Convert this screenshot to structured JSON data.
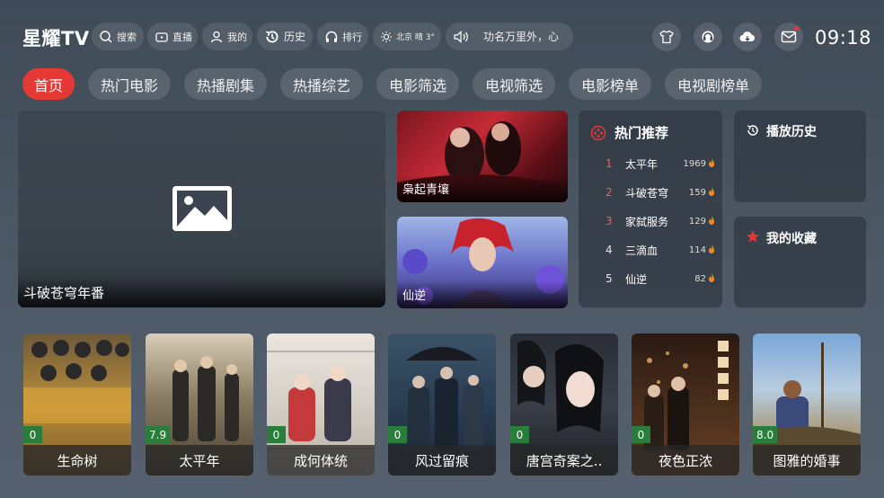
{
  "app": {
    "title": "星耀TV",
    "time": "09:18"
  },
  "topbar": {
    "search": "搜索",
    "live": "直播",
    "mine": "我的",
    "history": "历史",
    "ranking": "排行",
    "weather": "北京 晴 3°",
    "ticker": "功名万里外，心"
  },
  "tabs": [
    "首页",
    "热门电影",
    "热播剧集",
    "热播综艺",
    "电影筛选",
    "电视筛选",
    "电影榜单",
    "电视剧榜单"
  ],
  "featured": {
    "title": "斗破苍穹年番"
  },
  "side_cards": [
    {
      "title": "枭起青壤"
    },
    {
      "title": "仙逆"
    }
  ],
  "hot": {
    "title": "热门推荐",
    "items": [
      {
        "rank": "1",
        "name": "太平年",
        "count": "1969"
      },
      {
        "rank": "2",
        "name": "斗破苍穹年番",
        "count": "159"
      },
      {
        "rank": "3",
        "name": "家弑服务",
        "count": "129"
      },
      {
        "rank": "4",
        "name": "三滴血",
        "count": "114"
      },
      {
        "rank": "5",
        "name": "仙逆",
        "count": "82"
      }
    ]
  },
  "play_history": {
    "title": "播放历史"
  },
  "favorites": {
    "title": "我的收藏"
  },
  "posters": [
    {
      "title": "生命树",
      "score": "0"
    },
    {
      "title": "太平年",
      "score": "7.9"
    },
    {
      "title": "成何体统",
      "score": "0"
    },
    {
      "title": "风过留痕",
      "score": "0"
    },
    {
      "title": "唐宫奇案之..",
      "score": "0"
    },
    {
      "title": "夜色正浓",
      "score": "0"
    },
    {
      "title": "图雅的婚事",
      "score": "8.0"
    }
  ],
  "colors": {
    "accent": "#e53935",
    "score_bg": "#2a7d3a"
  }
}
